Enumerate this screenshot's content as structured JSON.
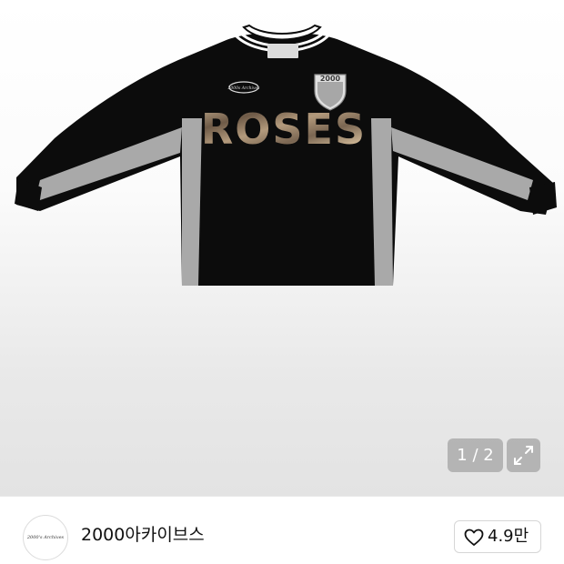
{
  "gallery": {
    "page_indicator": "1 / 2",
    "product_print": "ROSES",
    "badge_number": "2000",
    "chest_patch_text": "2000s Archives"
  },
  "seller": {
    "name": "2000아카이브스",
    "avatar_text": "2000's Archives",
    "likes": "4.9만"
  },
  "colors": {
    "jersey": "#0c0c0c",
    "side_panel": "#a9a9a9",
    "print_tan": "#b39a7c",
    "print_brown": "#6e5a47",
    "overlay": "#8c8c8c"
  }
}
